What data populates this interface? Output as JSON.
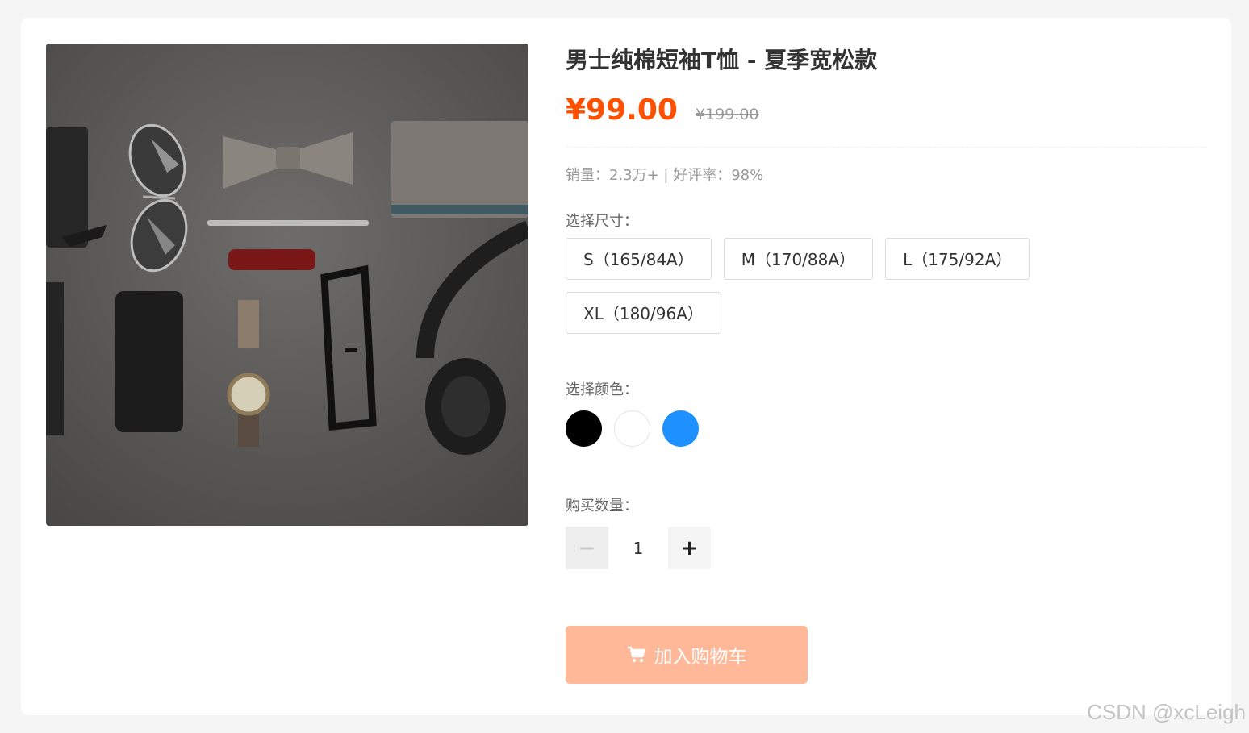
{
  "product": {
    "title": "男士纯棉短袖T恤 - 夏季宽松款",
    "price": "¥99.00",
    "original_price": "¥199.00",
    "stats": "销量：2.3万+ | 好评率：98%"
  },
  "size": {
    "label": "选择尺寸：",
    "options": [
      "S（165/84A）",
      "M（170/88A）",
      "L（175/92A）",
      "XL（180/96A）"
    ]
  },
  "color": {
    "label": "选择颜色：",
    "options": [
      {
        "name": "black",
        "hex": "#000000"
      },
      {
        "name": "white",
        "hex": "#ffffff"
      },
      {
        "name": "blue",
        "hex": "#1e90ff"
      }
    ]
  },
  "quantity": {
    "label": "购买数量：",
    "value": "1",
    "minus_symbol": "−",
    "plus_symbol": "+"
  },
  "cart": {
    "label": "加入购物车",
    "icon": "shopping-cart-icon"
  },
  "watermark": "CSDN @xcLeigh",
  "colors": {
    "price": "#ff5000",
    "cart_button": "#ffb999"
  }
}
